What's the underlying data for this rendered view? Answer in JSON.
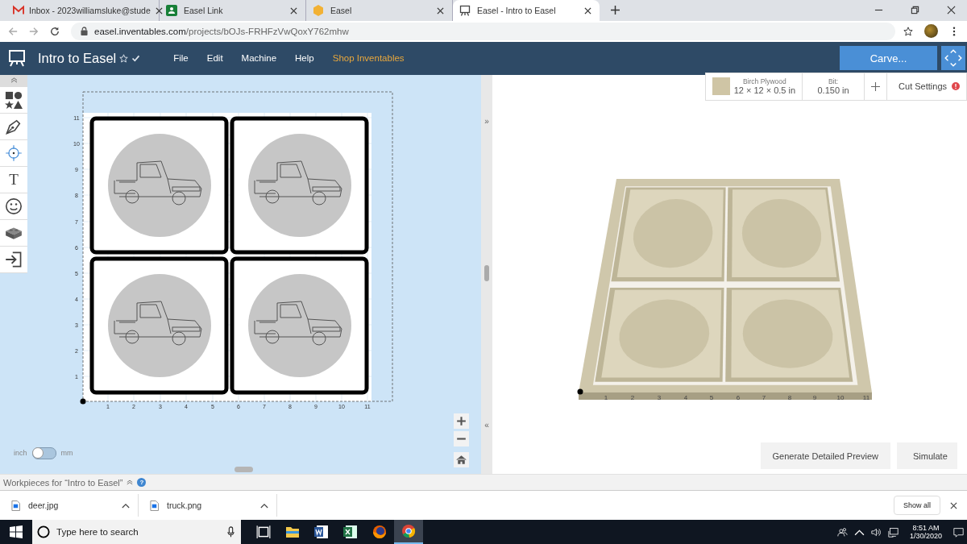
{
  "browser": {
    "tabs": [
      {
        "title": "Inbox - 2023williamsluke@stude",
        "selected": false
      },
      {
        "title": "Easel Link",
        "selected": false
      },
      {
        "title": "Easel",
        "selected": false
      },
      {
        "title": "Easel - Intro to Easel",
        "selected": true
      }
    ],
    "url_host": "easel.inventables.com",
    "url_path": "/projects/bOJs-FRHFzVwQoxY762mhw"
  },
  "app": {
    "title": "Intro to Easel",
    "menu": [
      {
        "label": "File",
        "kind": "menu"
      },
      {
        "label": "Edit",
        "kind": "menu"
      },
      {
        "label": "Machine",
        "kind": "menu"
      },
      {
        "label": "Help",
        "kind": "menu"
      },
      {
        "label": "Shop Inventables",
        "kind": "link"
      }
    ],
    "carve_button": "Carve..."
  },
  "material": {
    "name": "Birch Plywood",
    "size": "12 × 12 × 0.5 in",
    "color": "#cfc5a5"
  },
  "bit": {
    "label": "Bit:",
    "value": "0.150 in"
  },
  "cut_settings": {
    "label": "Cut Settings",
    "warning": true
  },
  "tools": [
    {
      "kind": "shapes"
    },
    {
      "kind": "pen"
    },
    {
      "kind": "target"
    },
    {
      "kind": "text",
      "glyph": "T"
    },
    {
      "kind": "smiley"
    },
    {
      "kind": "brick"
    },
    {
      "kind": "import"
    }
  ],
  "design": {
    "y_ticks": [
      "11",
      "10",
      "9",
      "8",
      "7",
      "6",
      "5",
      "4",
      "3",
      "2",
      "1"
    ],
    "x_ticks": [
      "1",
      "2",
      "3",
      "4",
      "5",
      "6",
      "7",
      "8",
      "9",
      "10",
      "11"
    ]
  },
  "units": {
    "left": "inch",
    "right": "mm",
    "metric": false
  },
  "collapse_right": "»",
  "collapse_left": "«",
  "preview": {
    "x_ticks": [
      "1",
      "2",
      "3",
      "4",
      "5",
      "6",
      "7",
      "8",
      "9",
      "10",
      "11"
    ],
    "detail_button": "Generate Detailed Preview",
    "simulate_button": "Simulate"
  },
  "workpieces": {
    "title": "Workpieces for “Intro to Easel”",
    "help": "?"
  },
  "downloads": {
    "items": [
      {
        "name": "deer.jpg"
      },
      {
        "name": "truck.png"
      }
    ],
    "show_all": "Show all"
  },
  "taskbar": {
    "search_placeholder": "Type here to search",
    "time": "8:51 AM",
    "date": "1/30/2020"
  }
}
